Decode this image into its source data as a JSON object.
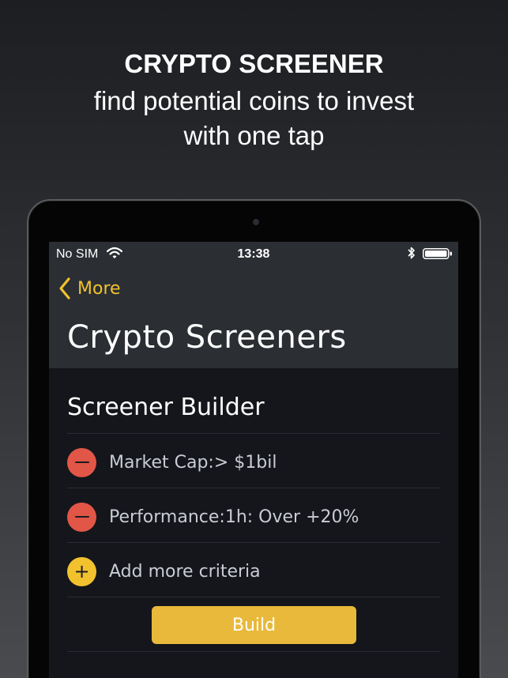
{
  "promo": {
    "title": "CRYPTO SCREENER",
    "subtitle_line1": "find potential coins to invest",
    "subtitle_line2": "with one tap"
  },
  "status_bar": {
    "carrier": "No SIM",
    "time": "13:38",
    "icons": [
      "wifi-icon",
      "bluetooth-icon",
      "battery-icon"
    ]
  },
  "nav": {
    "back_label": "More",
    "title": "Crypto Screeners"
  },
  "builder": {
    "section_title": "Screener Builder",
    "criteria": [
      {
        "label": "Market Cap:> $1bil",
        "action": "remove"
      },
      {
        "label": "Performance:1h: Over +20%",
        "action": "remove"
      }
    ],
    "add_label": "Add more criteria",
    "add_symbol": "+",
    "build_label": "Build"
  },
  "colors": {
    "accent": "#f2c22e",
    "remove": "#e15647",
    "build_button": "#e8b93a",
    "screen_bg": "#14161b",
    "nav_bg": "#2b2e33"
  }
}
